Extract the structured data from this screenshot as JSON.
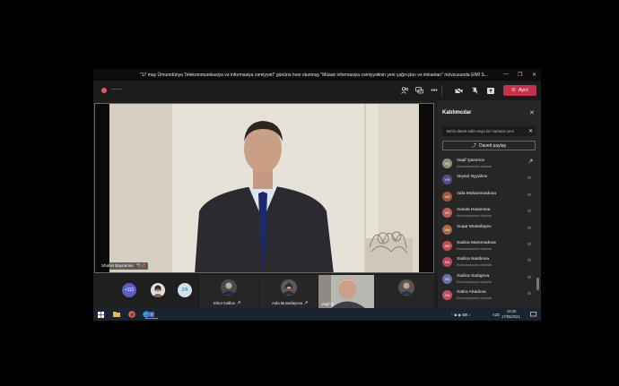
{
  "window": {
    "title": "\"17 may Ümumdünya Telekommunikasiya və informasiya cəmiyyəti\" gününə həsr olunmuş \"Müasir informasiya cəmiyyətinin yeni çağırışları və imkanları\" mövzusunda ElMİ S...",
    "minimize_icon": "minimize-icon",
    "maximize_icon": "maximize-icon",
    "close_icon": "close-icon"
  },
  "toolbar": {
    "timer": "—:—",
    "leave_label": "Ayrıl",
    "accent": "#c4314b"
  },
  "main_video": {
    "name": "Shahin Bayramov"
  },
  "strip": {
    "overflow_count": "+111",
    "za_initials": "ZA",
    "tiles": [
      {
        "name": "Elnur Kalilov"
      },
      {
        "name": "Aida Mustafayeva"
      },
      {
        "name": "Vaqif Q"
      }
    ]
  },
  "panel": {
    "title": "Katılımcılar",
    "invite_placeholder": "Birini davet edin veya bir numara çevi",
    "share_label": "Daveti paylaş",
    "participants": [
      {
        "name": "Vaqif Qasımov",
        "status": "Kuruluşunuzun dışında",
        "initials": "VQ",
        "color": "#8a8f7a"
      },
      {
        "name": "Veysəl Əyyubov",
        "status": "",
        "initials": "VƏ",
        "color": "#5a4b8c"
      },
      {
        "name": "Vafa Muhammədova",
        "status": "",
        "initials": "VM",
        "color": "#9c5a3a"
      },
      {
        "name": "Vusala Hasanova",
        "status": "Kuruluşunuzun dışında",
        "initials": "VH",
        "color": "#c15a5a"
      },
      {
        "name": "Vuqar Mustafayev",
        "status": "",
        "initials": "VM",
        "color": "#a46a42"
      },
      {
        "name": "Xadica Mammadova",
        "status": "Kuruluşunuzun dışında",
        "initials": "XM",
        "color": "#c0504d"
      },
      {
        "name": "Xadica Nasibova",
        "status": "Kuruluşunuzun dışında",
        "initials": "XN",
        "color": "#b8485d"
      },
      {
        "name": "Xadica Sadıgova",
        "status": "Kuruluşunuzun dışında",
        "initials": "XS",
        "color": "#6b6fa8"
      },
      {
        "name": "Xatira Ahadova",
        "status": "Kuruluşunuzun dışında",
        "initials": "XA",
        "color": "#c05060"
      }
    ]
  },
  "taskbar": {
    "lang": "AZE",
    "time": "16:20",
    "date": "17/05/2021"
  }
}
